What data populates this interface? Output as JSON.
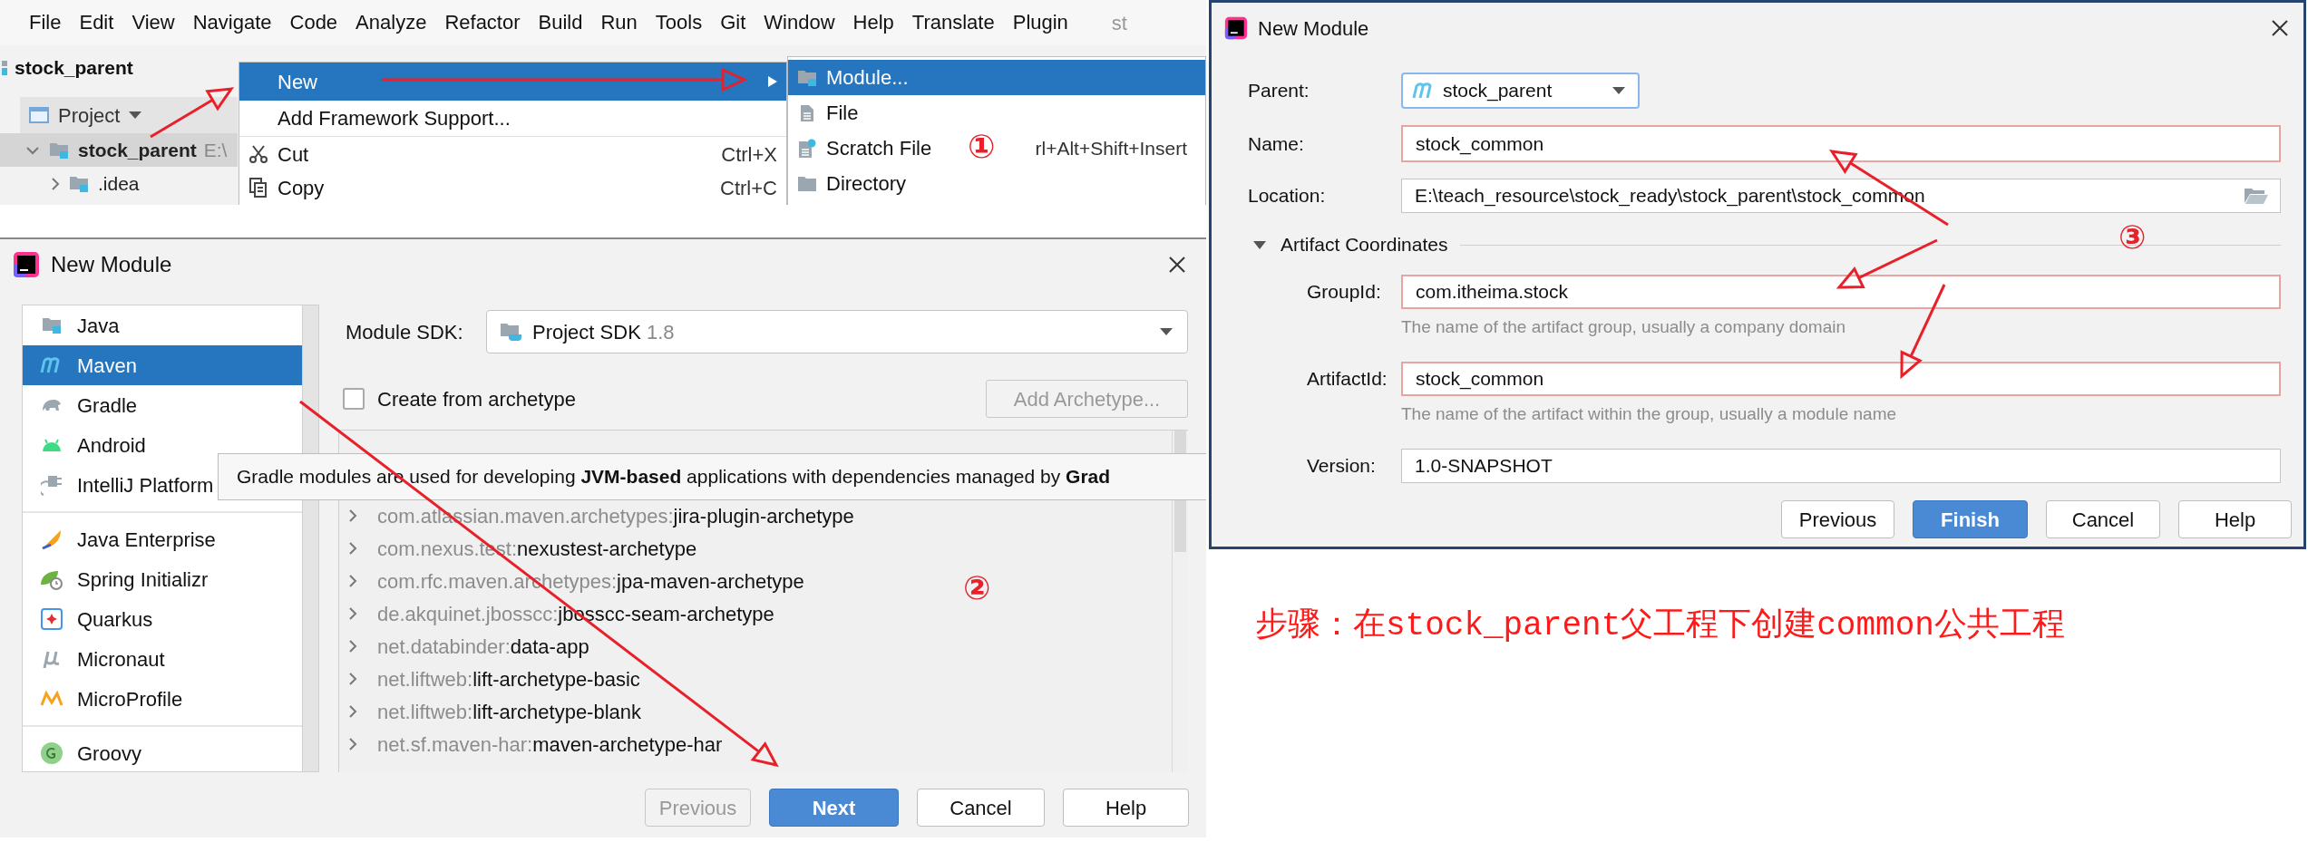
{
  "ide": {
    "menu": [
      "File",
      "Edit",
      "View",
      "Navigate",
      "Code",
      "Analyze",
      "Refactor",
      "Build",
      "Run",
      "Tools",
      "Git",
      "Window",
      "Help",
      "Translate",
      "Plugin"
    ],
    "title_fragment": "st",
    "project_title": "stock_parent",
    "project_view": "Project",
    "tree": [
      {
        "label": "stock_parent",
        "path": "E:\\",
        "expanded": true,
        "selected": true,
        "children": [
          {
            "label": ".idea",
            "expanded": false,
            "selected": false
          }
        ]
      }
    ],
    "context_menu": [
      {
        "label": "New",
        "selected": true,
        "kind": "submenu"
      },
      {
        "label": "Add Framework Support...",
        "selected": false,
        "kind": "action"
      },
      {
        "label": "Cut",
        "shortcut": "Ctrl+X",
        "selected": false,
        "kind": "action"
      },
      {
        "label": "Copy",
        "shortcut": "Ctrl+C",
        "selected": false,
        "kind": "action"
      }
    ],
    "submenu": [
      {
        "label": "Module...",
        "selected": true
      },
      {
        "label": "File",
        "selected": false
      },
      {
        "label": "Scratch File",
        "shortcut": "rl+Alt+Shift+Insert",
        "selected": false
      },
      {
        "label": "Directory",
        "selected": false
      }
    ]
  },
  "module_type_dialog": {
    "title": "New Module",
    "category_groups": [
      {
        "items": [
          {
            "label": "Java",
            "selected": false
          },
          {
            "label": "Maven",
            "selected": true
          },
          {
            "label": "Gradle",
            "selected": false
          },
          {
            "label": "Android",
            "selected": false
          },
          {
            "label": "IntelliJ Platform",
            "selected": false
          }
        ]
      },
      {
        "items": [
          {
            "label": "Java Enterprise",
            "selected": false
          },
          {
            "label": "Spring Initializr",
            "selected": false
          },
          {
            "label": "Quarkus",
            "selected": false
          },
          {
            "label": "Micronaut",
            "selected": false
          },
          {
            "label": "MicroProfile",
            "selected": false
          }
        ]
      },
      {
        "items": [
          {
            "label": "Groovy",
            "selected": false
          }
        ]
      }
    ],
    "module_sdk": {
      "label": "Module SDK:",
      "value": "Project SDK",
      "version": "1.8"
    },
    "create_from_archetype": {
      "label": "Create from archetype",
      "checked": false
    },
    "add_archetype_button": {
      "label": "Add Archetype...",
      "disabled": true
    },
    "archetypes": [
      {
        "group": "com.atlassian.maven.archetypes:",
        "artifact": "jira-plugin-archetype",
        "expanded": false
      },
      {
        "group": "com.nexus.test:",
        "artifact": "nexustest-archetype",
        "expanded": false
      },
      {
        "group": "com.rfc.maven.archetypes:",
        "artifact": "jpa-maven-archetype",
        "expanded": false
      },
      {
        "group": "de.akquinet.jbosscc:",
        "artifact": "jbosscc-seam-archetype",
        "expanded": false
      },
      {
        "group": "net.databinder:",
        "artifact": "data-app",
        "expanded": false
      },
      {
        "group": "net.liftweb:",
        "artifact": "lift-archetype-basic",
        "expanded": false
      },
      {
        "group": "net.liftweb:",
        "artifact": "lift-archetype-blank",
        "expanded": false
      },
      {
        "group": "net.sf.maven-har:",
        "artifact": "maven-archetype-har",
        "expanded": false
      }
    ],
    "tooltip": "Gradle modules are used for developing **JVM-based** applications with dependencies managed by **Grad**",
    "buttons": [
      {
        "label": "Previous",
        "disabled": true,
        "primary": false
      },
      {
        "label": "Next",
        "disabled": false,
        "primary": true
      },
      {
        "label": "Cancel",
        "disabled": false,
        "primary": false
      },
      {
        "label": "Help",
        "disabled": false,
        "primary": false
      }
    ]
  },
  "maven_dialog": {
    "title": "New Module",
    "fields": [
      {
        "kind": "dropdown",
        "label": "Parent:",
        "value": "stock_parent",
        "highlighted": false
      },
      {
        "kind": "text",
        "label": "Name:",
        "value": "stock_common",
        "highlighted": true
      },
      {
        "kind": "path",
        "label": "Location:",
        "value": "E:\\teach_resource\\stock_ready\\stock_parent\\stock_common",
        "highlighted": false
      }
    ],
    "artifact_section": {
      "title": "Artifact Coordinates",
      "expanded": true,
      "fields": [
        {
          "label": "GroupId:",
          "value": "com.itheima.stock",
          "highlighted": true,
          "hint": "The name of the artifact group, usually a company domain"
        },
        {
          "label": "ArtifactId:",
          "value": "stock_common",
          "highlighted": true,
          "hint": "The name of the artifact within the group, usually a module name"
        },
        {
          "label": "Version:",
          "value": "1.0-SNAPSHOT",
          "highlighted": false
        }
      ]
    },
    "buttons": [
      {
        "label": "Previous",
        "disabled": false,
        "primary": false
      },
      {
        "label": "Finish",
        "disabled": false,
        "primary": true
      },
      {
        "label": "Cancel",
        "disabled": false,
        "primary": false
      },
      {
        "label": "Help",
        "disabled": false,
        "primary": false
      }
    ]
  },
  "step_markers": [
    "①",
    "②",
    "③"
  ],
  "caption": "步骤：在stock_parent父工程下创建common公共工程"
}
